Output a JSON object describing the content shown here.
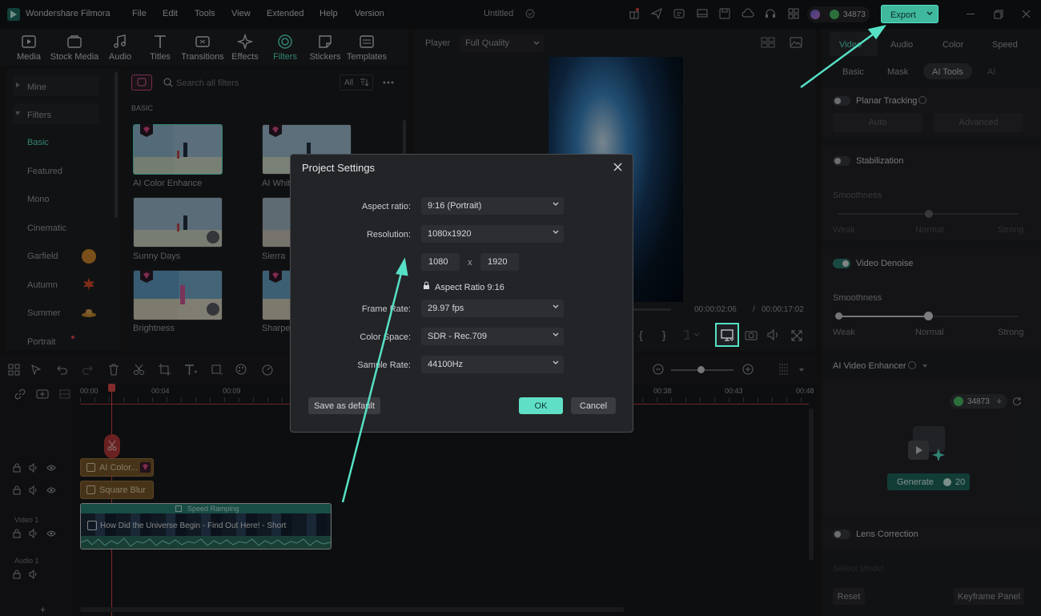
{
  "app": {
    "name": "Wondershare Filmora",
    "menu": [
      "File",
      "Edit",
      "Tools",
      "View",
      "Extended",
      "Help",
      "Version"
    ],
    "project_title": "Untitled",
    "credits": "34873",
    "export_label": "Export"
  },
  "toolbar": {
    "items": [
      "Media",
      "Stock Media",
      "Audio",
      "Titles",
      "Transitions",
      "Effects",
      "Filters",
      "Stickers",
      "Templates"
    ],
    "active": "Filters"
  },
  "left_nav": {
    "mine": "Mine",
    "filters": "Filters",
    "items": [
      "Basic",
      "Featured",
      "Mono",
      "Cinematic",
      "Garfield",
      "Autumn",
      "Summer",
      "Portrait"
    ]
  },
  "filters": {
    "search_placeholder": "Search all filters",
    "filter_all": "All",
    "section": "BASIC",
    "thumbs": [
      "AI Color Enhance",
      "AI Whit",
      "Sunny Days",
      "Sierra",
      "Brightness",
      "Sharpe"
    ]
  },
  "player": {
    "label": "Player",
    "quality": "Full Quality",
    "current_time": "00:00:02:06",
    "separator": "/",
    "total_time": "00:00:17:02"
  },
  "right_panel": {
    "tabs": [
      "Video",
      "Audio",
      "Color",
      "Speed"
    ],
    "subtabs": [
      "Basic",
      "Mask",
      "AI Tools",
      "AI"
    ],
    "planar_tracking": "Planar Tracking",
    "auto": "Auto",
    "advanced": "Advanced",
    "stabilization": "Stabilization",
    "smoothness": "Smoothness",
    "weak": "Weak",
    "normal": "Normal",
    "strong": "Strong",
    "video_denoise": "Video Denoise",
    "ai_video_enhancer": "AI Video Enhancer",
    "enhancer_credits": "34873",
    "generate_label": "Generate",
    "generate_cost": "20",
    "lens_correction": "Lens Correction",
    "select_model": "Select Model",
    "reset": "Reset",
    "keyframe_panel": "Keyframe Panel"
  },
  "timeline": {
    "ruler": [
      "00:00",
      "00:04",
      "00:09",
      "00:38",
      "00:43",
      "00:48"
    ],
    "clip_ai_color": "AI Color...",
    "clip_square_blur": "Square Blur",
    "speed_ramping": "Speed Ramping",
    "video_clip_title": "How Did the Universe Begin - Find Out Here! - Short",
    "video_track": "Video 1",
    "audio_track": "Audio 1"
  },
  "dialog": {
    "title": "Project Settings",
    "aspect_ratio_label": "Aspect ratio:",
    "aspect_ratio_value": "9:16 (Portrait)",
    "resolution_label": "Resolution:",
    "resolution_value": "1080x1920",
    "width": "1080",
    "times": "x",
    "height": "1920",
    "aspect_lock_text": "Aspect Ratio 9:16",
    "frame_rate_label": "Frame Rate:",
    "frame_rate_value": "29.97 fps",
    "color_space_label": "Color Space:",
    "color_space_value": "SDR - Rec.709",
    "sample_rate_label": "Sample Rate:",
    "sample_rate_value": "44100Hz",
    "save_default": "Save as default",
    "ok": "OK",
    "cancel": "Cancel"
  },
  "colors": {
    "accent": "#56e1c6",
    "ok_button": "#5fe0c6",
    "export_button": "#3fb89e",
    "playhead": "#e04a4a"
  }
}
